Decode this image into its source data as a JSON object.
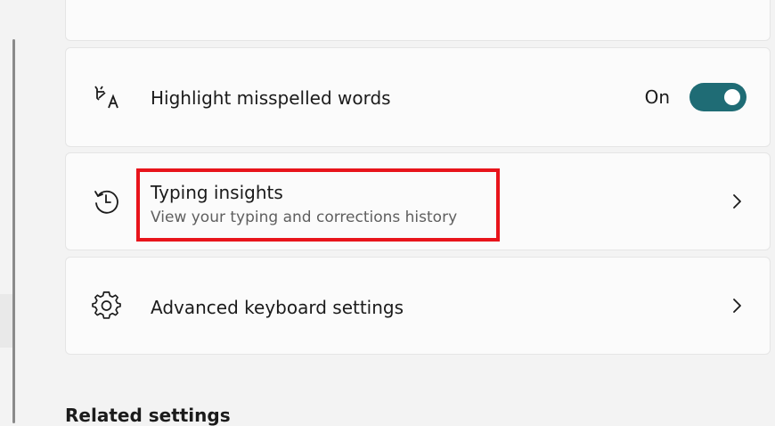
{
  "settings": {
    "highlight_misspelled": {
      "label": "Highlight misspelled words",
      "state_label": "On",
      "enabled": true,
      "icon": "spellcheck-icon"
    },
    "typing_insights": {
      "label": "Typing insights",
      "description": "View your typing and corrections history",
      "icon": "history-icon"
    },
    "advanced_keyboard": {
      "label": "Advanced keyboard settings",
      "icon": "gear-icon"
    }
  },
  "related_settings": {
    "heading": "Related settings"
  },
  "colors": {
    "toggle_on": "#1f6c75",
    "annotation": "#e8141b"
  }
}
